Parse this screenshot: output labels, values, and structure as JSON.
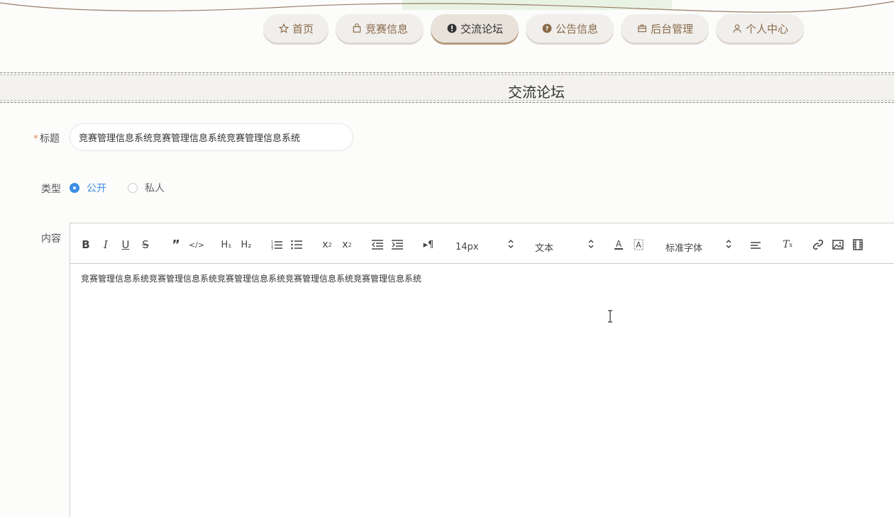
{
  "nav": {
    "items": [
      {
        "label": "首页",
        "icon": "star-icon"
      },
      {
        "label": "竞赛信息",
        "icon": "bag-icon"
      },
      {
        "label": "交流论坛",
        "icon": "exclamation-icon",
        "active": true
      },
      {
        "label": "公告信息",
        "icon": "question-icon"
      },
      {
        "label": "后台管理",
        "icon": "briefcase-icon"
      },
      {
        "label": "个人中心",
        "icon": "user-icon"
      }
    ]
  },
  "section": {
    "title": "交流论坛"
  },
  "form": {
    "title_label": "标题",
    "title_required": "*",
    "title_value": "竞赛管理信息系统竞赛管理信息系统竞赛管理信息系统",
    "type_label": "类型",
    "type_options": [
      "公开",
      "私人"
    ],
    "type_selected": "公开",
    "content_label": "内容"
  },
  "editor": {
    "font_size": "14px",
    "header_select": "文本",
    "font_family": "标准字体",
    "content": "竞赛管理信息系统竞赛管理信息系统竞赛管理信息系统竞赛管理信息系统竞赛管理信息系统"
  },
  "colors": {
    "accent": "#3a8ee6",
    "nav_text": "#8a6a4a",
    "required": "#e0925a"
  }
}
